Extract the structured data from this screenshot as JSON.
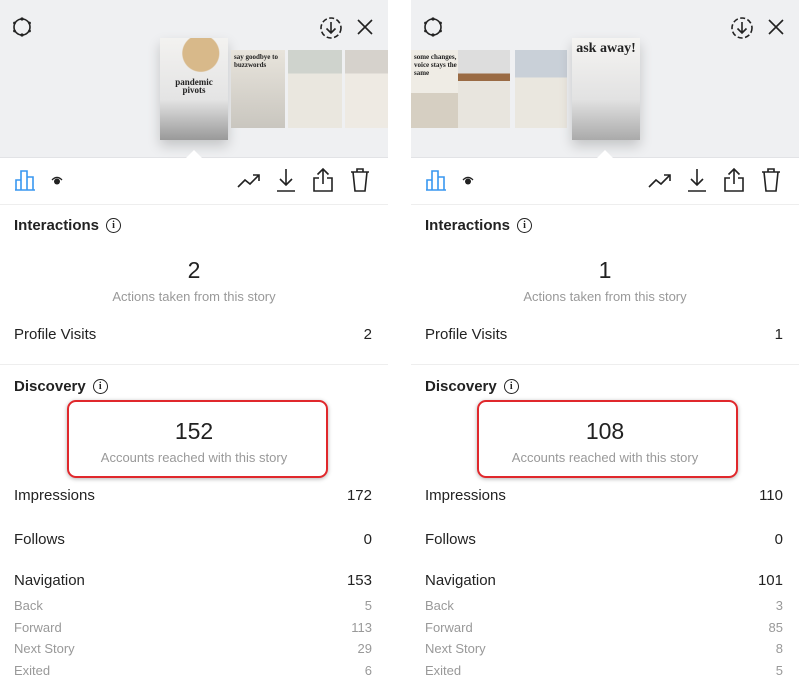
{
  "colors": {
    "accent": "#3897f0",
    "highlight": "#e0282c",
    "background": "#eff0f2"
  },
  "icons": [
    "gear-icon",
    "save-circle-download-icon",
    "close-icon",
    "bar-chart-icon",
    "eye-icon",
    "trend-icon",
    "download-icon",
    "share-icon",
    "trash-icon"
  ],
  "panels": [
    {
      "thumbnails": [
        "pandemic pivots",
        "say goodbye to buzzwords",
        "",
        ""
      ],
      "interactions": {
        "title": "Interactions",
        "count": "2",
        "count_label": "Actions taken from this story",
        "profile_visits_label": "Profile Visits",
        "profile_visits": "2"
      },
      "discovery": {
        "title": "Discovery",
        "reach": "152",
        "reach_label": "Accounts reached with this story",
        "rows": [
          {
            "label": "Impressions",
            "value": "172"
          },
          {
            "label": "Follows",
            "value": "0"
          },
          {
            "label": "Navigation",
            "value": "153"
          }
        ],
        "nav": [
          {
            "label": "Back",
            "value": "5"
          },
          {
            "label": "Forward",
            "value": "113"
          },
          {
            "label": "Next Story",
            "value": "29"
          },
          {
            "label": "Exited",
            "value": "6"
          }
        ]
      }
    },
    {
      "thumbnails": [
        "some changes, voice stays the same",
        "",
        "",
        "ask away!"
      ],
      "interactions": {
        "title": "Interactions",
        "count": "1",
        "count_label": "Actions taken from this story",
        "profile_visits_label": "Profile Visits",
        "profile_visits": "1"
      },
      "discovery": {
        "title": "Discovery",
        "reach": "108",
        "reach_label": "Accounts reached with this story",
        "rows": [
          {
            "label": "Impressions",
            "value": "110"
          },
          {
            "label": "Follows",
            "value": "0"
          },
          {
            "label": "Navigation",
            "value": "101"
          }
        ],
        "nav": [
          {
            "label": "Back",
            "value": "3"
          },
          {
            "label": "Forward",
            "value": "85"
          },
          {
            "label": "Next Story",
            "value": "8"
          },
          {
            "label": "Exited",
            "value": "5"
          }
        ]
      }
    }
  ]
}
